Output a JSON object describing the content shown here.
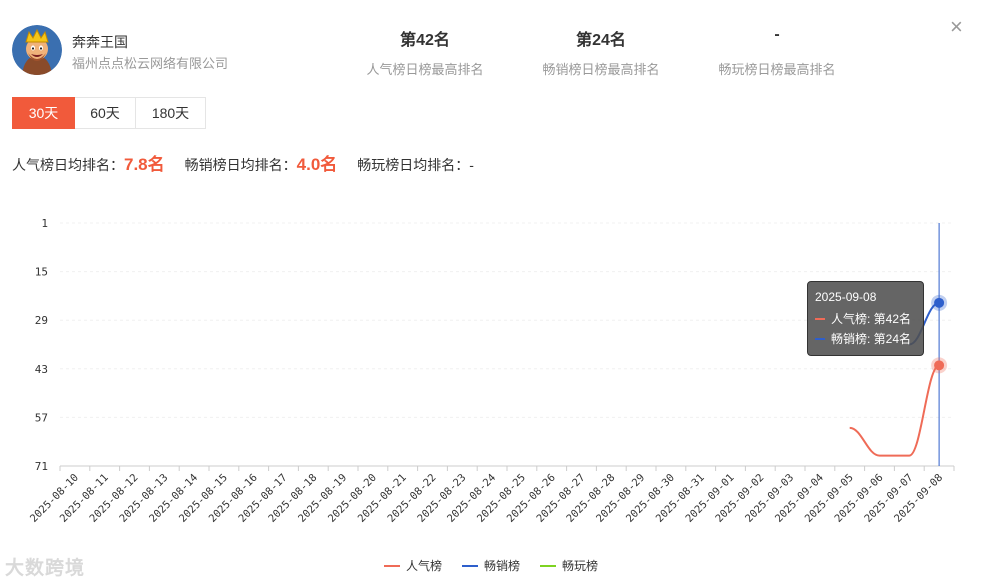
{
  "app": {
    "name": "奔奔王国",
    "company": "福州点点松云网络有限公司",
    "icon": "game-character-avatar"
  },
  "stats": [
    {
      "value": "第42名",
      "label": "人气榜日榜最高排名"
    },
    {
      "value": "第24名",
      "label": "畅销榜日榜最高排名"
    },
    {
      "value": "-",
      "label": "畅玩榜日榜最高排名"
    }
  ],
  "close_icon": "×",
  "tabs": [
    {
      "label": "30天",
      "active": true
    },
    {
      "label": "60天",
      "active": false
    },
    {
      "label": "180天",
      "active": false
    }
  ],
  "averages": [
    {
      "label": "人气榜日均排名：",
      "value": "7.8名"
    },
    {
      "label": "畅销榜日均排名：",
      "value": "4.0名"
    },
    {
      "label": "畅玩榜日均排名：",
      "value": "-"
    }
  ],
  "colors": {
    "accent": "#f15a3b",
    "popularity": "#ef6b57",
    "bestseller": "#2e5fcc",
    "play": "#7ed321"
  },
  "chart_data": {
    "type": "line",
    "categories": [
      "2025-08-10",
      "2025-08-11",
      "2025-08-12",
      "2025-08-13",
      "2025-08-14",
      "2025-08-15",
      "2025-08-16",
      "2025-08-17",
      "2025-08-18",
      "2025-08-19",
      "2025-08-20",
      "2025-08-21",
      "2025-08-22",
      "2025-08-23",
      "2025-08-24",
      "2025-08-25",
      "2025-08-26",
      "2025-08-27",
      "2025-08-28",
      "2025-08-29",
      "2025-08-30",
      "2025-08-31",
      "2025-09-01",
      "2025-09-02",
      "2025-09-03",
      "2025-09-04",
      "2025-09-05",
      "2025-09-06",
      "2025-09-07",
      "2025-09-08"
    ],
    "y_ticks": [
      1,
      15,
      29,
      43,
      57,
      71
    ],
    "ylim": [
      1,
      71
    ],
    "y_inverted": true,
    "grid": true,
    "series": [
      {
        "name": "人气榜",
        "color": "#ef6b57",
        "points": [
          [
            "2025-09-05",
            60
          ],
          [
            "2025-09-06",
            68
          ],
          [
            "2025-09-07",
            68
          ],
          [
            "2025-09-08",
            42
          ]
        ]
      },
      {
        "name": "畅销榜",
        "color": "#2e5fcc",
        "points": [
          [
            "2025-09-07",
            36
          ],
          [
            "2025-09-08",
            24
          ]
        ]
      },
      {
        "name": "畅玩榜",
        "color": "#7ed321",
        "points": []
      }
    ],
    "tooltip": {
      "date": "2025-09-08",
      "rows": [
        {
          "label": "人气榜: 第42名",
          "color": "#ef6b57"
        },
        {
          "label": "畅销榜: 第24名",
          "color": "#2e5fcc"
        }
      ]
    },
    "legend_position": "bottom-center"
  },
  "watermark": "大数跨境"
}
